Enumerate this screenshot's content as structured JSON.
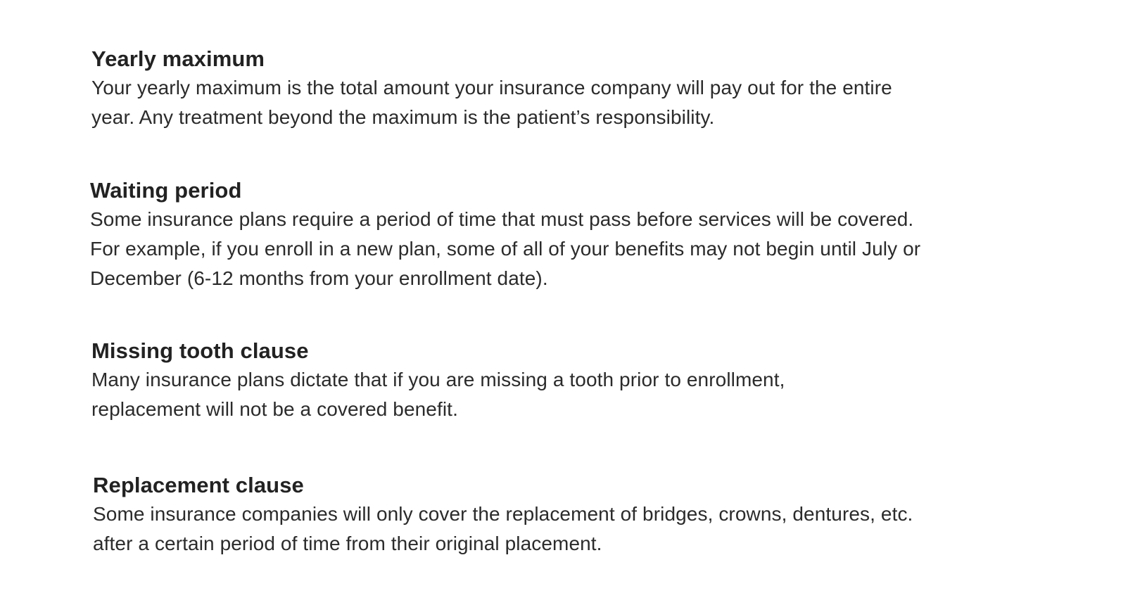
{
  "top_fragment": "",
  "sections": [
    {
      "heading": "Yearly maximum",
      "lines": [
        "Your yearly maximum is the total amount your insurance company will pay out for the entire",
        "year. Any treatment beyond the maximum is the patient’s responsibility."
      ]
    },
    {
      "heading": "Waiting period",
      "lines": [
        "Some insurance plans require a period of time that must pass before services will be covered.",
        "For example, if you enroll in a new plan, some of all of your benefits may not begin until July or",
        "December (6-12 months from your enrollment date)."
      ]
    },
    {
      "heading": "Missing tooth clause",
      "lines": [
        "Many insurance plans dictate that if you are missing a tooth prior to enrollment,",
        "replacement will not be a covered benefit."
      ]
    },
    {
      "heading": "Replacement clause",
      "lines": [
        "Some insurance companies will only cover the replacement of bridges, crowns, dentures, etc.",
        "after a certain period of time from their original placement."
      ]
    }
  ]
}
